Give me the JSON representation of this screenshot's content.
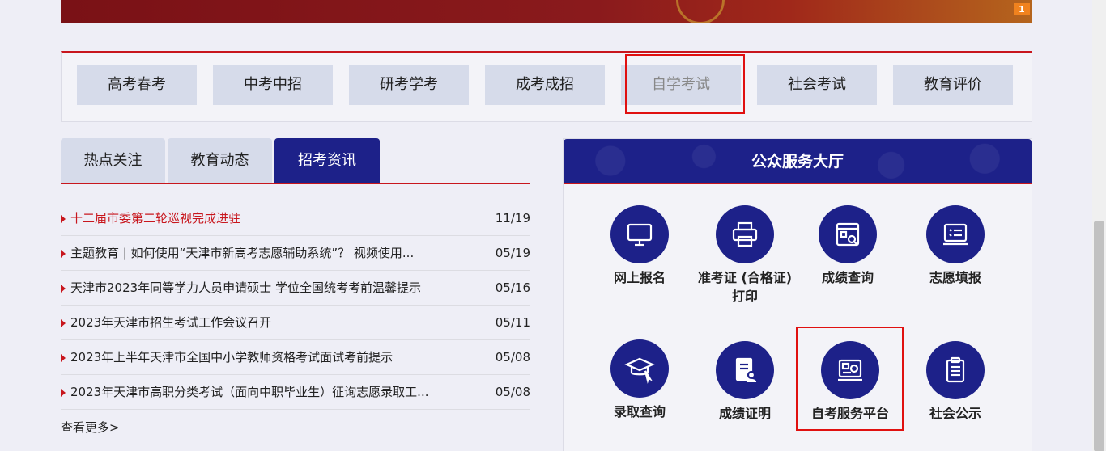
{
  "banner": {
    "badge": "1"
  },
  "categories": [
    {
      "label": "高考春考"
    },
    {
      "label": "中考中招"
    },
    {
      "label": "研考学考"
    },
    {
      "label": "成考成招"
    },
    {
      "label": "自学考试"
    },
    {
      "label": "社会考试"
    },
    {
      "label": "教育评价"
    }
  ],
  "tabs": [
    {
      "label": "热点关注"
    },
    {
      "label": "教育动态"
    },
    {
      "label": "招考资讯"
    }
  ],
  "news": [
    {
      "title": "十二届市委第二轮巡视完成进驻",
      "date": "11/19"
    },
    {
      "title": "主题教育 | 如何使用“天津市新高考志愿辅助系统”？ 视频使用...",
      "date": "05/19"
    },
    {
      "title": "天津市2023年同等学力人员申请硕士 学位全国统考考前温馨提示",
      "date": "05/16"
    },
    {
      "title": "2023年天津市招生考试工作会议召开",
      "date": "05/11"
    },
    {
      "title": "2023年上半年天津市全国中小学教师资格考试面试考前提示",
      "date": "05/08"
    },
    {
      "title": "2023年天津市高职分类考试（面向中职毕业生）征询志愿录取工...",
      "date": "05/08"
    }
  ],
  "more_label": "查看更多>",
  "service": {
    "title": "公众服务大厅",
    "items": [
      {
        "label": "网上报名",
        "icon": "monitor-icon"
      },
      {
        "label": "准考证 (合格证) 打印",
        "icon": "printer-icon"
      },
      {
        "label": "成绩查询",
        "icon": "score-query-icon"
      },
      {
        "label": "志愿填报",
        "icon": "checklist-icon"
      },
      {
        "label": "录取查询",
        "icon": "graduation-cap-icon"
      },
      {
        "label": "成绩证明",
        "icon": "certificate-icon"
      },
      {
        "label": "自考服务平台",
        "icon": "platform-icon"
      },
      {
        "label": "社会公示",
        "icon": "clipboard-icon"
      }
    ]
  },
  "colors": {
    "brand_blue": "#1d2189",
    "brand_red": "#c8161d",
    "highlight": "#e01010"
  }
}
